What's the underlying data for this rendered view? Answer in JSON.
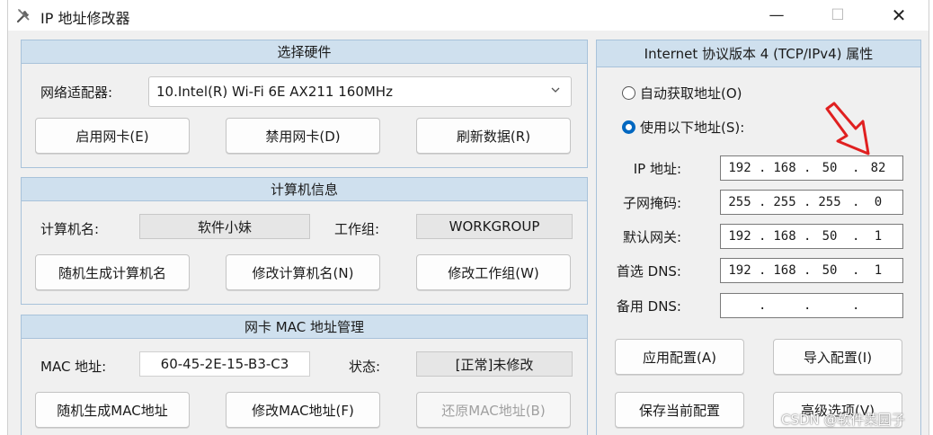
{
  "window": {
    "title": "IP 地址修改器",
    "minimize": "—",
    "maximize": "☐",
    "close": "✕"
  },
  "hardware": {
    "header": "选择硬件",
    "adapter_label": "网络适配器:",
    "adapter_value": "10.Intel(R) Wi-Fi 6E AX211 160MHz",
    "enable_btn": "启用网卡(E)",
    "disable_btn": "禁用网卡(D)",
    "refresh_btn": "刷新数据(R)"
  },
  "computer": {
    "header": "计算机信息",
    "name_label": "计算机名:",
    "name_value": "软件小妹",
    "workgroup_label": "工作组:",
    "workgroup_value": "WORKGROUP",
    "random_btn": "随机生成计算机名",
    "rename_btn": "修改计算机名(N)",
    "workgroup_btn": "修改工作组(W)"
  },
  "mac": {
    "header": "网卡 MAC 地址管理",
    "mac_label": "MAC 地址:",
    "mac_value": "60-45-2E-15-B3-C3",
    "status_label": "状态:",
    "status_value": "[正常]未修改",
    "random_btn": "随机生成MAC地址",
    "modify_btn": "修改MAC地址(F)",
    "restore_btn": "还原MAC地址(B)"
  },
  "ipv4": {
    "header": "Internet 协议版本 4 (TCP/IPv4) 属性",
    "auto_label": "自动获取地址(O)",
    "manual_label": "使用以下地址(S):",
    "selected": "manual",
    "ip_label": "IP 地址:",
    "ip": [
      "192",
      "168",
      "50",
      "82"
    ],
    "mask_label": "子网掩码:",
    "mask": [
      "255",
      "255",
      "255",
      "0"
    ],
    "gateway_label": "默认网关:",
    "gateway": [
      "192",
      "168",
      "50",
      "1"
    ],
    "dns1_label": "首选 DNS:",
    "dns1": [
      "192",
      "168",
      "50",
      "1"
    ],
    "dns2_label": "备用 DNS:",
    "dns2": [
      "",
      "",
      "",
      ""
    ],
    "separator": ".",
    "apply_btn": "应用配置(A)",
    "import_btn": "导入配置(I)",
    "save_btn": "保存当前配置",
    "advanced_btn": "高级选项(V)"
  },
  "watermark": "CSDN @软件菜园子",
  "colors": {
    "panel_header": "#cfe0ee",
    "panel_border": "#a8c2da",
    "radio_selected": "#0067c0",
    "annotation_arrow": "#e02020"
  }
}
